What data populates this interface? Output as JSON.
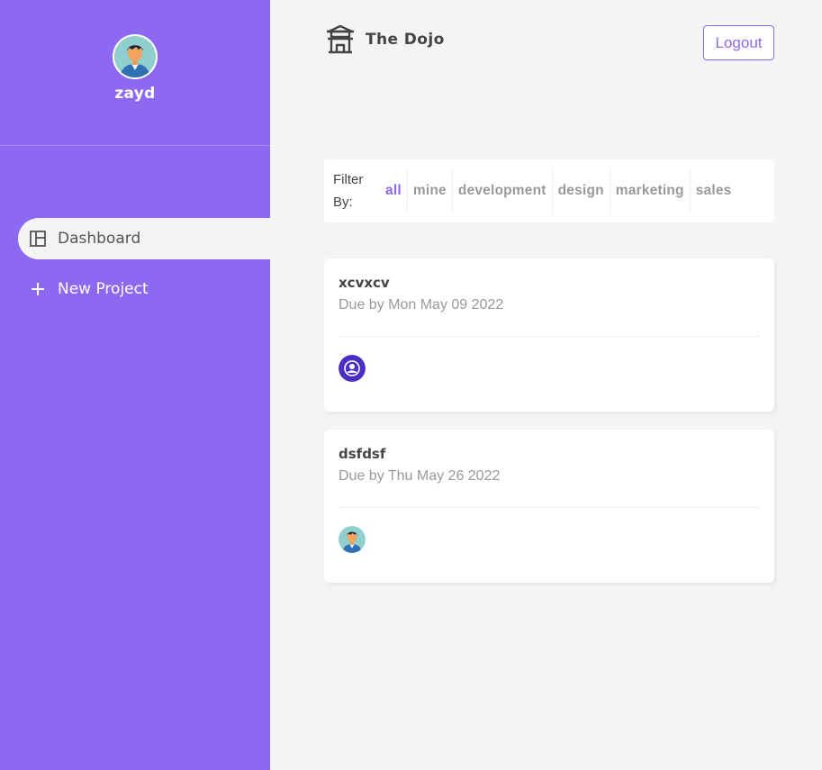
{
  "user": {
    "name": "zayd",
    "avatar_icon": "user-avatar-icon"
  },
  "nav": [
    {
      "label": "Dashboard",
      "icon": "dashboard-icon",
      "active": true
    },
    {
      "label": "New Project",
      "icon": "plus-icon",
      "active": false
    }
  ],
  "header": {
    "title": "The Dojo",
    "logo_icon": "temple-icon",
    "logout_label": "Logout"
  },
  "filter": {
    "label": "Filter By:",
    "options": [
      "all",
      "mine",
      "development",
      "design",
      "marketing",
      "sales"
    ],
    "active": "all"
  },
  "projects": [
    {
      "name": "xcvxcv",
      "due": "Due by Mon May 09 2022",
      "assignee_icon": "default-user-icon"
    },
    {
      "name": "dsfdsf",
      "due": "Due by Thu May 26 2022",
      "assignee_icon": "user-avatar-icon"
    }
  ],
  "colors": {
    "accent": "#8d69f1",
    "background": "#f4f4f4",
    "muted": "#999999",
    "text": "#444444",
    "assignee_default": "#4b2fc4"
  }
}
